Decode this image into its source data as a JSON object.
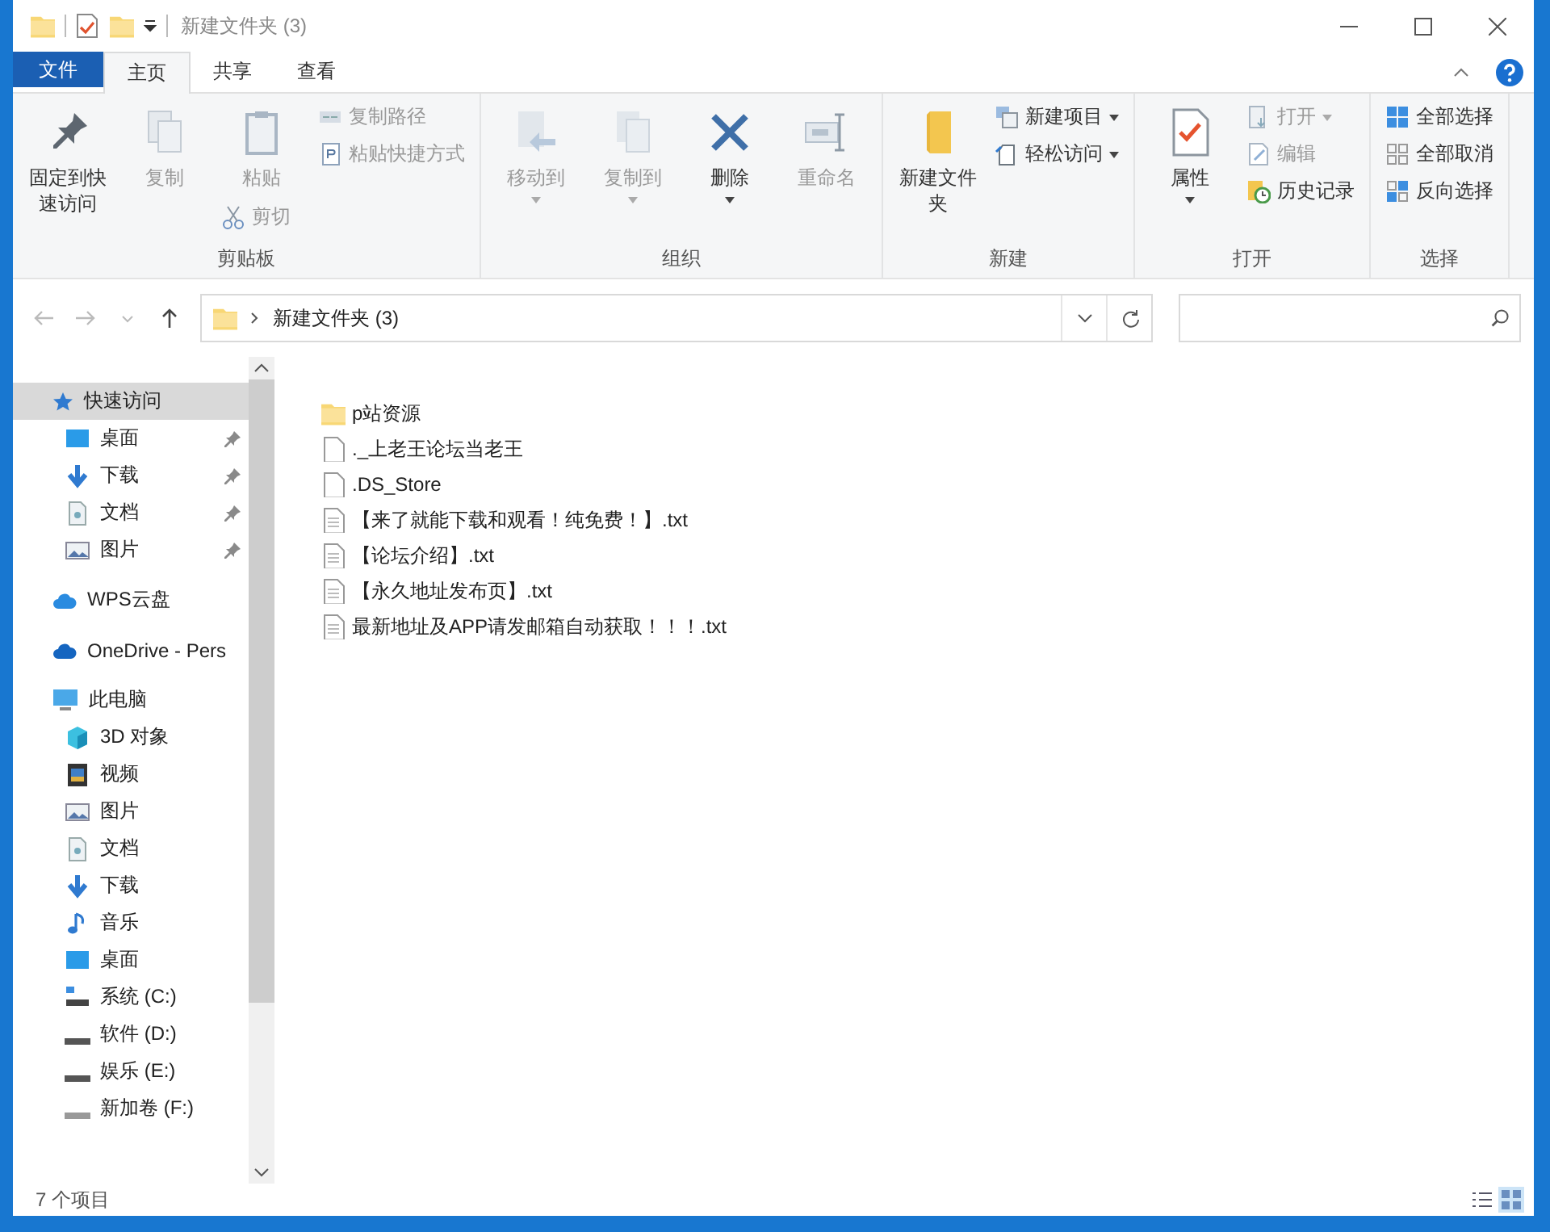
{
  "window": {
    "title": "新建文件夹 (3)"
  },
  "ribbon": {
    "tabs": [
      {
        "label": "文件",
        "kind": "file",
        "selected": false
      },
      {
        "label": "主页",
        "kind": "tab",
        "selected": true
      },
      {
        "label": "共享",
        "kind": "tab",
        "selected": false
      },
      {
        "label": "查看",
        "kind": "tab",
        "selected": false
      }
    ],
    "groups": [
      {
        "label": "剪贴板",
        "columns": [
          [
            {
              "label": "固定到快速访问",
              "kind": "large",
              "disabled": false,
              "dropdown": false
            }
          ],
          [
            {
              "label": "复制",
              "kind": "large",
              "disabled": true,
              "dropdown": false
            }
          ],
          [
            {
              "label": "粘贴",
              "kind": "large",
              "disabled": true,
              "dropdown": false
            },
            {
              "label": "剪切",
              "kind": "small",
              "disabled": true,
              "dropdown": false
            }
          ],
          [
            {
              "label": "复制路径",
              "kind": "small",
              "disabled": true,
              "dropdown": false
            },
            {
              "label": "粘贴快捷方式",
              "kind": "small",
              "disabled": true,
              "dropdown": false
            }
          ]
        ]
      },
      {
        "label": "组织",
        "columns": [
          [
            {
              "label": "移动到",
              "kind": "large",
              "disabled": true,
              "dropdown": true
            }
          ],
          [
            {
              "label": "复制到",
              "kind": "large",
              "disabled": true,
              "dropdown": true
            }
          ],
          [
            {
              "label": "删除",
              "kind": "large",
              "disabled": false,
              "dropdown": true
            }
          ],
          [
            {
              "label": "重命名",
              "kind": "large",
              "disabled": true,
              "dropdown": false
            }
          ]
        ]
      },
      {
        "label": "新建",
        "columns": [
          [
            {
              "label": "新建文件夹",
              "kind": "large",
              "disabled": false,
              "dropdown": false
            }
          ],
          [
            {
              "label": "新建项目",
              "kind": "small",
              "disabled": false,
              "dropdown": true
            },
            {
              "label": "轻松访问",
              "kind": "small",
              "disabled": false,
              "dropdown": true
            }
          ]
        ]
      },
      {
        "label": "打开",
        "columns": [
          [
            {
              "label": "属性",
              "kind": "large",
              "disabled": false,
              "dropdown": true
            }
          ],
          [
            {
              "label": "打开",
              "kind": "small",
              "disabled": true,
              "dropdown": true
            },
            {
              "label": "编辑",
              "kind": "small",
              "disabled": true,
              "dropdown": false
            },
            {
              "label": "历史记录",
              "kind": "small",
              "disabled": false,
              "dropdown": false
            }
          ]
        ]
      },
      {
        "label": "选择",
        "columns": [
          [
            {
              "label": "全部选择",
              "kind": "small",
              "disabled": false,
              "dropdown": false
            },
            {
              "label": "全部取消",
              "kind": "small",
              "disabled": false,
              "dropdown": false
            },
            {
              "label": "反向选择",
              "kind": "small",
              "disabled": false,
              "dropdown": false
            }
          ]
        ]
      }
    ]
  },
  "address_bar": {
    "path": "新建文件夹 (3)"
  },
  "sidebar": {
    "sections": [
      {
        "label": "快速访问",
        "selected": true,
        "children": [
          {
            "label": "桌面",
            "pinned": true
          },
          {
            "label": "下载",
            "pinned": true
          },
          {
            "label": "文档",
            "pinned": true
          },
          {
            "label": "图片",
            "pinned": true
          }
        ]
      },
      {
        "label": "WPS云盘",
        "selected": false
      },
      {
        "label": "OneDrive - Pers",
        "selected": false
      },
      {
        "label": "此电脑",
        "selected": false,
        "children": [
          {
            "label": "3D 对象"
          },
          {
            "label": "视频"
          },
          {
            "label": "图片"
          },
          {
            "label": "文档"
          },
          {
            "label": "下载"
          },
          {
            "label": "音乐"
          },
          {
            "label": "桌面"
          },
          {
            "label": "系统 (C:)"
          },
          {
            "label": "软件 (D:)"
          },
          {
            "label": "娱乐 (E:)"
          },
          {
            "label": "新加卷 (F:)"
          }
        ]
      }
    ]
  },
  "files": [
    {
      "name": "p站资源",
      "kind": "folder"
    },
    {
      "name": "._上老王论坛当老王",
      "kind": "file"
    },
    {
      "name": ".DS_Store",
      "kind": "file"
    },
    {
      "name": "【来了就能下载和观看！纯免费！】.txt",
      "kind": "text"
    },
    {
      "name": "【论坛介绍】.txt",
      "kind": "text"
    },
    {
      "name": "【永久地址发布页】.txt",
      "kind": "text"
    },
    {
      "name": "最新地址及APP请发邮箱自动获取！！！.txt",
      "kind": "text"
    }
  ],
  "status_bar": {
    "count": "7 个项目"
  }
}
